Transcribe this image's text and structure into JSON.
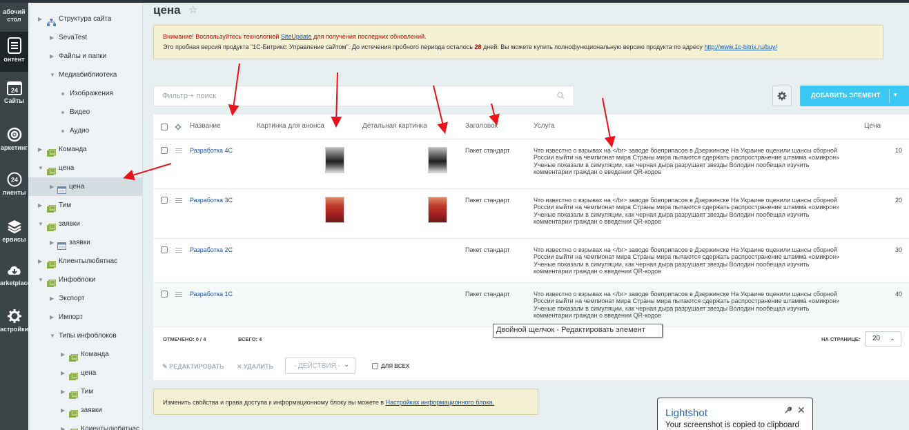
{
  "left_panel": {
    "items": [
      {
        "label": "Рабочий стол",
        "lines": [
          "абочий",
          "стол"
        ],
        "icon": "desktop-icon"
      },
      {
        "label": "Контент",
        "lines": [
          "онтент"
        ],
        "icon": "content-icon"
      },
      {
        "label": "Сайты",
        "lines": [
          "Сайты"
        ],
        "icon": "sites-calendar-icon",
        "badge": "24"
      },
      {
        "label": "Маркетинг",
        "lines": [
          "аркетинг"
        ],
        "icon": "target-icon"
      },
      {
        "label": "Клиенты",
        "lines": [
          "лиенты"
        ],
        "icon": "clients-24-icon",
        "badge": "24"
      },
      {
        "label": "Сервисы",
        "lines": [
          "ервисы"
        ],
        "icon": "layers-icon"
      },
      {
        "label": "Marketplace",
        "lines": [
          "arketplace"
        ],
        "icon": "cloud-download-icon"
      },
      {
        "label": "Настройки",
        "lines": [
          "астройки"
        ],
        "icon": "gear-icon"
      }
    ]
  },
  "tree": {
    "items": [
      {
        "label": "Структура сайта",
        "level": 0,
        "marker": "arrow",
        "icon": "sitemap-icon"
      },
      {
        "label": "SevaTest",
        "level": 1,
        "marker": "arrow"
      },
      {
        "label": "Файлы и папки",
        "level": 1,
        "marker": "arrow"
      },
      {
        "label": "Медиабиблиотека",
        "level": 1,
        "marker": "arrow-open"
      },
      {
        "label": "Изображения",
        "level": 2,
        "marker": "dot"
      },
      {
        "label": "Видео",
        "level": 2,
        "marker": "dot"
      },
      {
        "label": "Аудио",
        "level": 2,
        "marker": "dot"
      },
      {
        "label": "Команда",
        "level": 0,
        "marker": "arrow",
        "icon": "iblock-icon"
      },
      {
        "label": "цена",
        "level": 0,
        "marker": "arrow-open",
        "icon": "iblock-icon"
      },
      {
        "label": "цена",
        "level": 1,
        "marker": "arrow",
        "icon": "list-icon",
        "selected": true
      },
      {
        "label": "Тим",
        "level": 0,
        "marker": "arrow",
        "icon": "iblock-icon"
      },
      {
        "label": "заявки",
        "level": 0,
        "marker": "arrow-open",
        "icon": "iblock-icon"
      },
      {
        "label": "заявки",
        "level": 1,
        "marker": "arrow",
        "icon": "list-icon"
      },
      {
        "label": "Клиентылюбятнас",
        "level": 0,
        "marker": "arrow",
        "icon": "iblock-icon"
      },
      {
        "label": "Инфоблоки",
        "level": 0,
        "marker": "arrow-open",
        "icon": "iblock-gear-icon"
      },
      {
        "label": "Экспорт",
        "level": 1,
        "marker": "arrow"
      },
      {
        "label": "Импорт",
        "level": 1,
        "marker": "arrow"
      },
      {
        "label": "Типы инфоблоков",
        "level": 1,
        "marker": "arrow-open"
      },
      {
        "label": "Команда",
        "level": 2,
        "marker": "arrow",
        "icon": "iblock-icon"
      },
      {
        "label": "цена",
        "level": 2,
        "marker": "arrow",
        "icon": "iblock-icon"
      },
      {
        "label": "Тим",
        "level": 2,
        "marker": "arrow",
        "icon": "iblock-icon"
      },
      {
        "label": "заявки",
        "level": 2,
        "marker": "arrow",
        "icon": "iblock-icon"
      },
      {
        "label": "Клиентылюбятнас",
        "level": 2,
        "marker": "arrow",
        "icon": "iblock-icon"
      }
    ]
  },
  "page": {
    "title": "цена",
    "star_icon": "star-icon"
  },
  "warning": {
    "line1_before": "Внимание! Воспользуйтесь технологией ",
    "line1_link": "SiteUpdate",
    "line1_after": " для получения последних обновлений.",
    "line2_before": "Это пробная версия продукта \"1С-Битрикс: Управление сайтом\". До истечения пробного периода осталось ",
    "line2_days": "28",
    "line2_middle": " дней. Вы можете купить полнофункциональную версию продукта по адресу ",
    "line2_link": "http://www.1c-bitrix.ru/buy/"
  },
  "filter": {
    "placeholder": "Фильтр + поиск",
    "value": ""
  },
  "toolbar": {
    "add_label": "ДОБАВИТЬ ЭЛЕМЕНТ"
  },
  "grid": {
    "columns": {
      "name": "Название",
      "preview_pic": "Картинка для анонса",
      "detail_pic": "Детальная картинка",
      "heading": "Заголовок",
      "service": "Услуга",
      "price": "Цена"
    },
    "rows": [
      {
        "name": "Разработка 4С",
        "heading": "Пакет стандарт",
        "service": "Что известно о взрывах на </br> заводе боеприпасов в Дзержинске На Украине оценили шансы сборной России выйти на чемпионат мира Страны мира пытаются сдержать распространение штамма «омикрон» Ученые показали в симуляции, как черная дыра разрушает звезды Володин пообещал изучить комментарии граждан о введении QR-кодов",
        "price": "10",
        "photo": "bw"
      },
      {
        "name": "Разработка 3С",
        "heading": "Пакет стандарт",
        "service": "Что известно о взрывах на </br> заводе боеприпасов в Дзержинске На Украине оценили шансы сборной России выйти на чемпионат мира Страны мира пытаются сдержать распространение штамма «омикрон» Ученые показали в симуляции, как черная дыра разрушает звезды Володин пообещал изучить комментарии граждан о введении QR-кодов",
        "price": "20",
        "photo": "red"
      },
      {
        "name": "Разработка 2С",
        "heading": "Пакет стандарт",
        "service": "Что известно о взрывах на </br> заводе боеприпасов в Дзержинске На Украине оценили шансы сборной России выйти на чемпионат мира Страны мира пытаются сдержать распространение штамма «омикрон» Ученые показали в симуляции, как черная дыра разрушает звезды Володин пообещал изучить комментарии граждан о введении QR-кодов",
        "price": "30",
        "photo": ""
      },
      {
        "name": "Разработка 1С",
        "heading": "Пакет стандарт",
        "service": "Что известно о взрывах на </br> заводе боеприпасов в Дзержинске На Украине оценили шансы сборной России выйти на чемпионат мира Страны мира пытаются сдержать распространение штамма «омикрон» Ученые показали в симуляции, как черная дыра разрушает звезды Володин пообещал изучить комментарии граждан о введении QR-кодов",
        "price": "40",
        "photo": ""
      }
    ],
    "footer": {
      "checked": "ОТМЕЧЕНО: 0 / 4",
      "total": "ВСЕГО: 4",
      "per_page_label": "НА СТРАНИЦЕ:",
      "per_page_value": "20"
    },
    "actions": {
      "edit": "РЕДАКТИРОВАТЬ",
      "delete": "УДАЛИТЬ",
      "actions_select": "- ДЕЙСТВИЯ -",
      "for_all": "ДЛЯ ВСЕХ"
    }
  },
  "tooltip": "Двойной щелчок - Редактировать элемент",
  "info": {
    "text": "Изменить свойства и права доступа к информационному блоку вы можете в ",
    "link": "Настройках информационного блока."
  },
  "lightshot": {
    "title": "Lightshot",
    "message": "Your screenshot is copied to clipboard"
  },
  "colors": {
    "accent": "#3bc8f5",
    "link": "#1e5099",
    "warning_bg": "#f3f0d4",
    "annotation_arrow": "#e8141c"
  }
}
